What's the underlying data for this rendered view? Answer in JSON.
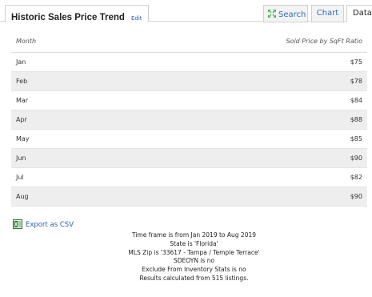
{
  "header": {
    "title": "Historic Sales Price Trend",
    "edit_label": "Edit",
    "tabs": {
      "search": "Search",
      "chart": "Chart",
      "data": "Data"
    }
  },
  "table": {
    "columns": {
      "month": "Month",
      "price": "Sold Price by SqFt Ratio"
    },
    "rows": [
      {
        "month": "Jan",
        "price": "$75"
      },
      {
        "month": "Feb",
        "price": "$78"
      },
      {
        "month": "Mar",
        "price": "$84"
      },
      {
        "month": "Apr",
        "price": "$88"
      },
      {
        "month": "May",
        "price": "$85"
      },
      {
        "month": "Jun",
        "price": "$90"
      },
      {
        "month": "Jul",
        "price": "$82"
      },
      {
        "month": "Aug",
        "price": "$90"
      }
    ]
  },
  "export_label": "Export as CSV",
  "summary": [
    "Time frame is from Jan 2019 to Aug 2019",
    "State is 'Florida'",
    "MLS Zip is '33617 - Tampa / Temple Terrace'",
    "SDEOYN is no",
    "Exclude From Inventory Stats is no",
    "Results calculated from 515 listings."
  ],
  "colors": {
    "link": "#2a5db0",
    "tab_text": "#2a6fbf",
    "expand_icon": "#4caf50",
    "row_alt": "#eeeeee"
  },
  "icons": {
    "search_tab": "expand-arrows-icon",
    "export": "excel-file-icon"
  }
}
